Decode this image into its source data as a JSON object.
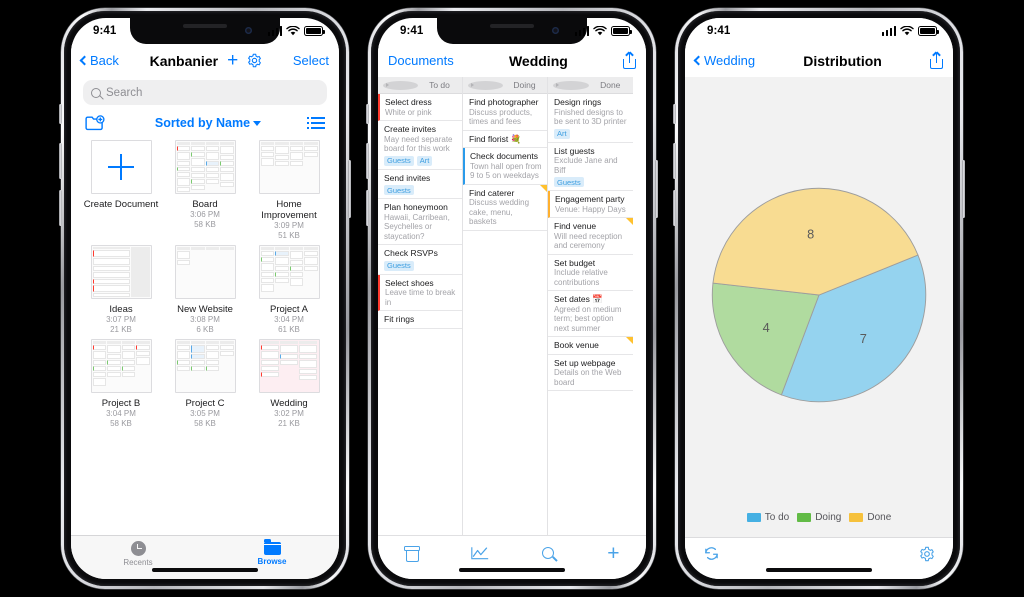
{
  "meta": {
    "accent_blue": "#007aff",
    "bg_black": "#000000"
  },
  "statusbar": {
    "time": "9:41",
    "signal_icon": "cellular-bars-icon",
    "wifi_icon": "wifi-icon",
    "battery_icon": "battery-icon"
  },
  "phone1": {
    "nav": {
      "back_label": "Back",
      "title": "Kanbanier",
      "add_icon": "plus-icon",
      "settings_icon": "gear-icon",
      "select_label": "Select"
    },
    "search": {
      "placeholder": "Search",
      "icon": "search-icon"
    },
    "toolbar": {
      "new_folder_icon": "new-folder-icon",
      "sort_label": "Sorted by Name",
      "caret_icon": "chevron-down-icon",
      "list_view_icon": "list-view-icon"
    },
    "files": [
      {
        "name": "Create Document",
        "time": "",
        "size": "",
        "thumb": "new-document"
      },
      {
        "name": "Board",
        "time": "3:06 PM",
        "size": "58 KB",
        "thumb": "kanban-dense"
      },
      {
        "name": "Home Improvement",
        "time": "3:09 PM",
        "size": "51 KB",
        "thumb": "kanban-light"
      },
      {
        "name": "Ideas",
        "time": "3:07 PM",
        "size": "21 KB",
        "thumb": "kanban-red"
      },
      {
        "name": "New Website",
        "time": "3:08 PM",
        "size": "6 KB",
        "thumb": "kanban-sparse"
      },
      {
        "name": "Project A",
        "time": "3:04 PM",
        "size": "61 KB",
        "thumb": "kanban-dense"
      },
      {
        "name": "Project B",
        "time": "3:04 PM",
        "size": "58 KB",
        "thumb": "kanban-dense"
      },
      {
        "name": "Project C",
        "time": "3:05 PM",
        "size": "58 KB",
        "thumb": "kanban-blue"
      },
      {
        "name": "Wedding",
        "time": "3:02 PM",
        "size": "21 KB",
        "thumb": "kanban-pink"
      }
    ],
    "tabs": [
      {
        "label": "Recents",
        "icon": "clock-icon",
        "selected": false
      },
      {
        "label": "Browse",
        "icon": "folder-icon",
        "selected": true
      }
    ]
  },
  "phone2": {
    "nav": {
      "back_label": "Documents",
      "title": "Wedding",
      "share_icon": "share-icon"
    },
    "columns": [
      {
        "title": "To do",
        "disclosure_icon": "disclosure-triangle-icon",
        "cards": [
          {
            "title": "Select dress",
            "desc": "White or pink",
            "bar": "red",
            "tags": []
          },
          {
            "title": "Create invites",
            "desc": "May need separate board for this work",
            "bar": "none",
            "tags": [
              "Guests",
              "Art"
            ]
          },
          {
            "title": "Send invites",
            "desc": "",
            "bar": "none",
            "tags": [
              "Guests"
            ]
          },
          {
            "title": "Plan honeymoon",
            "desc": "Hawaii, Carribean, Seychelles or staycation?",
            "bar": "none",
            "tags": []
          },
          {
            "title": "Check RSVPs",
            "desc": "",
            "bar": "none",
            "tags": [
              "Guests"
            ]
          },
          {
            "title": "Select shoes",
            "desc": "Leave time to break in",
            "bar": "red",
            "tags": []
          },
          {
            "title": "Fit rings",
            "desc": "",
            "bar": "none",
            "tags": []
          }
        ]
      },
      {
        "title": "Doing",
        "disclosure_icon": "disclosure-triangle-icon",
        "cards": [
          {
            "title": "Find photographer",
            "desc": "Discuss products, times and fees",
            "bar": "none",
            "tags": []
          },
          {
            "title": "Find florist 💐",
            "desc": "",
            "bar": "none",
            "tags": []
          },
          {
            "title": "Check documents",
            "desc": "Town hall open from 9 to 5 on weekdays",
            "bar": "blue",
            "tags": []
          },
          {
            "title": "Find caterer",
            "desc": "Discuss wedding cake, menu, baskets",
            "bar": "none",
            "corner": true,
            "tags": []
          }
        ]
      },
      {
        "title": "Done",
        "disclosure_icon": "disclosure-triangle-icon",
        "cards": [
          {
            "title": "Design rings",
            "desc": "Finished designs to be sent to 3D printer",
            "bar": "none",
            "tags": [
              "Art"
            ]
          },
          {
            "title": "List guests",
            "desc": "Exclude Jane and Biff",
            "bar": "none",
            "tags": [
              "Guests"
            ]
          },
          {
            "title": "Engagement party",
            "desc": "Venue: Happy Days",
            "bar": "orange",
            "tags": []
          },
          {
            "title": "Find venue",
            "desc": "Will need reception and ceremony",
            "bar": "none",
            "corner": true,
            "tags": []
          },
          {
            "title": "Set budget",
            "desc": "Include relative contributions",
            "bar": "none",
            "tags": []
          },
          {
            "title": "Set dates 📅",
            "desc": "Agreed on medium term; best option next summer",
            "bar": "none",
            "tags": []
          },
          {
            "title": "Book venue",
            "desc": "",
            "bar": "none",
            "corner": true,
            "tags": []
          },
          {
            "title": "Set up webpage",
            "desc": "Details on the Web board",
            "bar": "none",
            "tags": []
          }
        ]
      }
    ],
    "tabs": [
      {
        "icon": "archive-icon",
        "label": ""
      },
      {
        "icon": "chart-line-icon",
        "label": ""
      },
      {
        "icon": "search-icon",
        "label": ""
      },
      {
        "icon": "plus-icon",
        "label": ""
      }
    ]
  },
  "phone3": {
    "nav": {
      "back_label": "Wedding",
      "title": "Distribution",
      "share_icon": "share-icon"
    },
    "tabs": [
      {
        "icon": "refresh-icon",
        "label": ""
      },
      {
        "icon": "gear-icon",
        "label": ""
      }
    ],
    "chart_data": {
      "type": "pie",
      "title": "Distribution",
      "categories": [
        "To do",
        "Doing",
        "Done"
      ],
      "values": [
        7,
        4,
        8
      ],
      "labels": [
        "7",
        "4",
        "8"
      ],
      "colors": [
        "#95d3ef",
        "#b0db9f",
        "#f8dc92"
      ],
      "legend_colors": [
        "#45b0e3",
        "#62bb46",
        "#f6c13c"
      ],
      "legend_position": "bottom",
      "grid": false
    }
  }
}
